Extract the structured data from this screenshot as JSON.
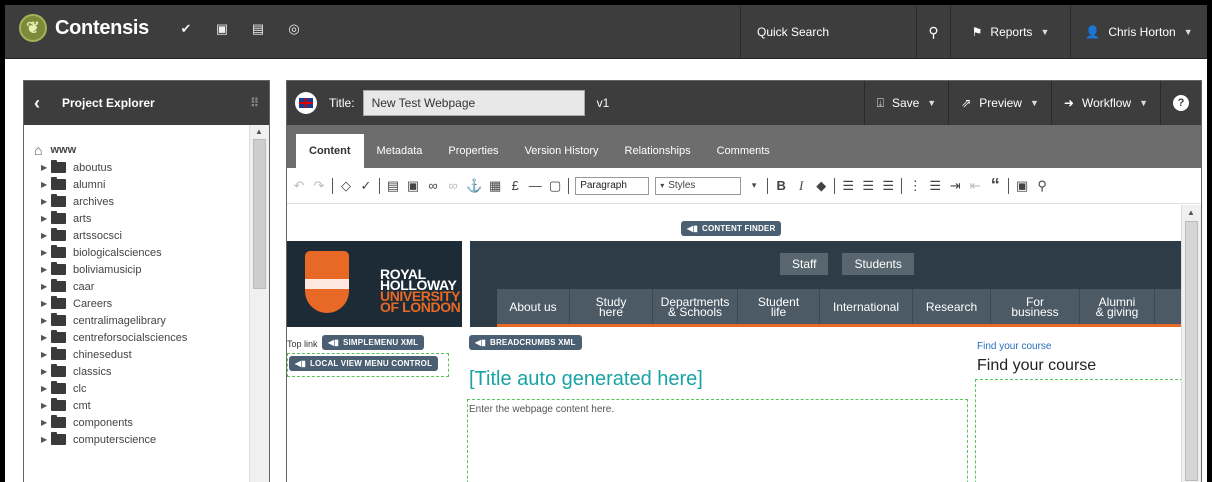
{
  "app": {
    "name": "Contensis",
    "top_icons": [
      "check-circle-icon",
      "image-icon",
      "layout-icon",
      "layers-icon"
    ],
    "quick_search_label": "Quick Search",
    "reports_label": "Reports",
    "user_name": "Chris Horton"
  },
  "sidebar": {
    "title": "Project Explorer",
    "root": "www",
    "items": [
      {
        "label": "aboutus"
      },
      {
        "label": "alumni"
      },
      {
        "label": "archives"
      },
      {
        "label": "arts"
      },
      {
        "label": "artssocsci"
      },
      {
        "label": "biologicalsciences"
      },
      {
        "label": "boliviamusicip"
      },
      {
        "label": "caar"
      },
      {
        "label": "Careers"
      },
      {
        "label": "centralimagelibrary"
      },
      {
        "label": "centreforsocialsciences"
      },
      {
        "label": "chinesedust"
      },
      {
        "label": "classics"
      },
      {
        "label": "clc"
      },
      {
        "label": "cmt"
      },
      {
        "label": "components"
      },
      {
        "label": "computerscience"
      }
    ]
  },
  "editor": {
    "title_label": "Title:",
    "title_value": "New Test Webpage",
    "version": "v1",
    "save_label": "Save",
    "preview_label": "Preview",
    "workflow_label": "Workflow",
    "help_label": "?",
    "tabs": [
      {
        "label": "Content"
      },
      {
        "label": "Metadata"
      },
      {
        "label": "Properties"
      },
      {
        "label": "Version History"
      },
      {
        "label": "Relationships"
      },
      {
        "label": "Comments"
      }
    ],
    "toolbar": {
      "format_value": "Paragraph",
      "styles_value": "Styles",
      "pound_symbol": "£",
      "bold_glyph": "B",
      "italic_glyph": "I",
      "quote_glyph": "“"
    }
  },
  "canvas": {
    "content_finder": "CONTENT FINDER",
    "simplemenu": "SIMPLEMENU XML",
    "breadcrumbs": "BREADCRUMBS XML",
    "local_view_menu": "LOCAL VIEW MENU CONTROL",
    "top_link": "Top link",
    "logo_line1": "ROYAL",
    "logo_line2": "HOLLOWAY",
    "logo_line3": "UNIVERSITY",
    "logo_line4": "OF LONDON",
    "top_links": [
      {
        "label": "Staff"
      },
      {
        "label": "Students"
      }
    ],
    "nav": [
      {
        "line1": "About us",
        "line2": ""
      },
      {
        "line1": "Study here",
        "line2": ""
      },
      {
        "line1": "Departments",
        "line2": "& Schools"
      },
      {
        "line1": "Student life",
        "line2": ""
      },
      {
        "line1": "International",
        "line2": ""
      },
      {
        "line1": "Research",
        "line2": ""
      },
      {
        "line1": "For business",
        "line2": ""
      },
      {
        "line1": "Alumni",
        "line2": "& giving"
      }
    ],
    "page_title": "[Title auto generated here]",
    "content_placeholder": "Enter the webpage content here.",
    "find_course_small": "Find your course",
    "find_course_big": "Find your course"
  },
  "colors": {
    "bar_dark": "#3d3d3d",
    "tab_bar": "#6d6d6d",
    "accent_teal": "#19a3a3",
    "rhul_orange": "#e86826",
    "chip_blue": "#4b5f73",
    "dashed_green": "#59c35b"
  }
}
